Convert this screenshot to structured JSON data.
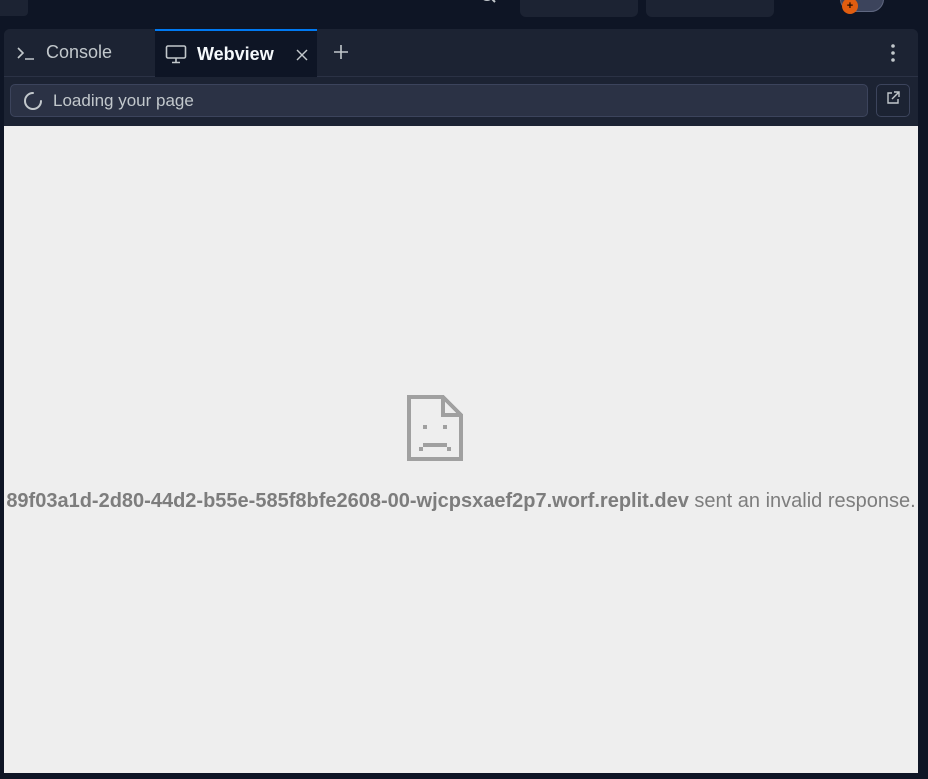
{
  "tabs": {
    "console_label": "Console",
    "webview_label": "Webview"
  },
  "urlbar": {
    "status_text": "Loading your page"
  },
  "error": {
    "host": "89f03a1d-2d80-44d2-b55e-585f8bfe2608-00-wjcpsxaef2p7.worf.replit.dev",
    "message": " sent an invalid response."
  },
  "colors": {
    "background": "#0e1525",
    "panel": "#1c2333",
    "active_tab_accent": "#0079f2",
    "viewport": "#eeeeee",
    "error_text": "#7d7d7d",
    "avatar_badge": "#e05d10"
  },
  "icons": {
    "console": "terminal-prompt-icon",
    "webview": "monitor-icon",
    "close": "close-icon",
    "add": "plus-icon",
    "menu": "kebab-menu-icon",
    "spinner": "loading-spinner-icon",
    "open_external": "open-external-icon",
    "error": "sad-page-icon"
  }
}
